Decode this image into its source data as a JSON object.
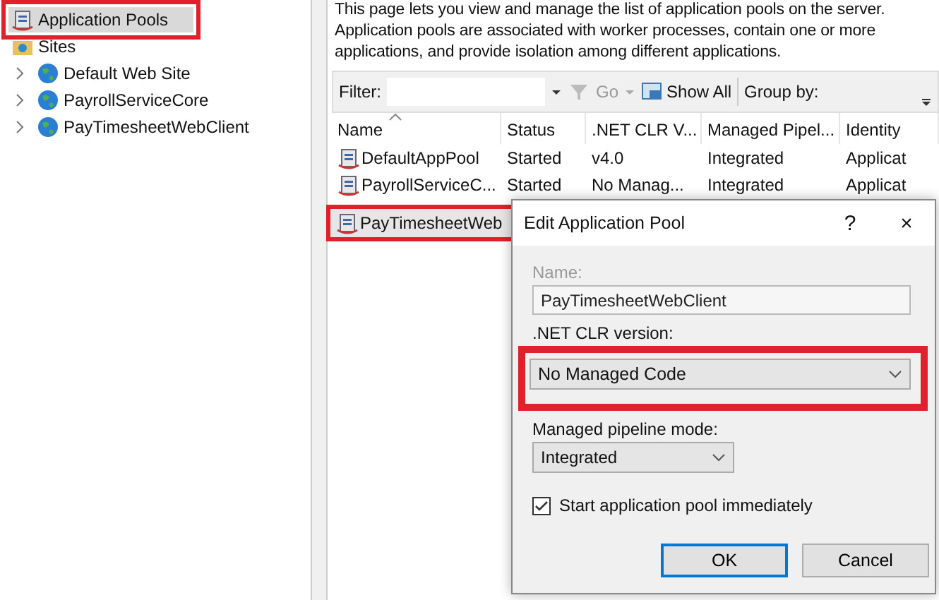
{
  "tree": {
    "items": [
      {
        "label": "Application Pools",
        "selected": true,
        "highlighted": true
      },
      {
        "label": "Sites",
        "selected": false,
        "highlighted": false,
        "children": [
          {
            "label": "Default Web Site",
            "expanded": false
          },
          {
            "label": "PayrollServiceCore",
            "expanded": false
          },
          {
            "label": "PayTimesheetWebClient",
            "expanded": false
          }
        ]
      }
    ]
  },
  "description": "This page lets you view and manage the list of application pools on the server. Application pools are associated with worker processes, contain one or more applications, and provide isolation among different applications.",
  "toolbar": {
    "filter_label": "Filter:",
    "go": "Go",
    "go_disabled": true,
    "show_all": "Show All",
    "group_by": "Group by:"
  },
  "table": {
    "columns": [
      "Name",
      "Status",
      ".NET CLR V...",
      "Managed Pipel...",
      "Identity"
    ],
    "rows": [
      {
        "cells": [
          "DefaultAppPool",
          "Started",
          "v4.0",
          "Integrated",
          "Applicat"
        ],
        "highlighted": false
      },
      {
        "cells": [
          "PayrollServiceC...",
          "Started",
          "No Manag...",
          "Integrated",
          "Applicat"
        ],
        "highlighted": false
      },
      {
        "cells": [
          "PayTimesheetWeb"
        ],
        "highlighted": true
      }
    ]
  },
  "dialog": {
    "title": "Edit Application Pool",
    "help": "?",
    "close": "×",
    "name_label": "Name:",
    "name_disabled": true,
    "name_value": "PayTimesheetWebClient",
    "clr_label": ".NET CLR version:",
    "clr_value": "No Managed Code",
    "clr_highlighted": true,
    "pipeline_label": "Managed pipeline mode:",
    "pipeline_value": "Integrated",
    "start_label": "Start application pool immediately",
    "start_checked": true,
    "buttons": [
      {
        "label": "OK",
        "default": true
      },
      {
        "label": "Cancel",
        "default": false
      }
    ]
  }
}
